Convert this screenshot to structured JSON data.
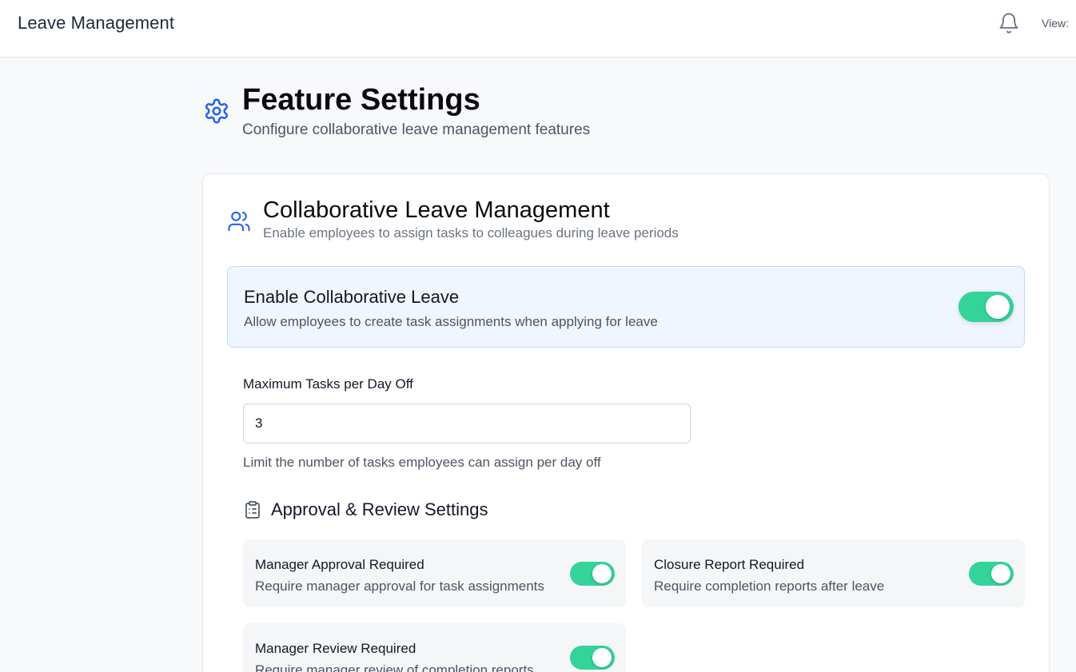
{
  "header": {
    "app_title": "Leave Management",
    "notification_icon": "bell-icon",
    "view_label": "View:"
  },
  "page": {
    "icon": "gear-icon",
    "title": "Feature Settings",
    "subtitle": "Configure collaborative leave management features"
  },
  "collab": {
    "icon": "users-icon",
    "title": "Collaborative Leave Management",
    "subtitle": "Enable employees to assign tasks to colleagues during leave periods",
    "enable": {
      "title": "Enable Collaborative Leave",
      "description": "Allow employees to create task assignments when applying for leave",
      "enabled": true
    },
    "max_tasks": {
      "label": "Maximum Tasks per Day Off",
      "value": "3",
      "help": "Limit the number of tasks employees can assign per day off"
    }
  },
  "approval": {
    "icon": "clipboard-list-icon",
    "title": "Approval & Review Settings",
    "settings": [
      {
        "title": "Manager Approval Required",
        "description": "Require manager approval for task assignments",
        "enabled": true
      },
      {
        "title": "Closure Report Required",
        "description": "Require completion reports after leave",
        "enabled": true
      },
      {
        "title": "Manager Review Required",
        "description": "Require manager review of completion reports",
        "enabled": true
      }
    ]
  },
  "colors": {
    "toggle_on": "#34d399",
    "accent_blue": "#2563eb",
    "enable_box_bg": "#eff6ff"
  }
}
